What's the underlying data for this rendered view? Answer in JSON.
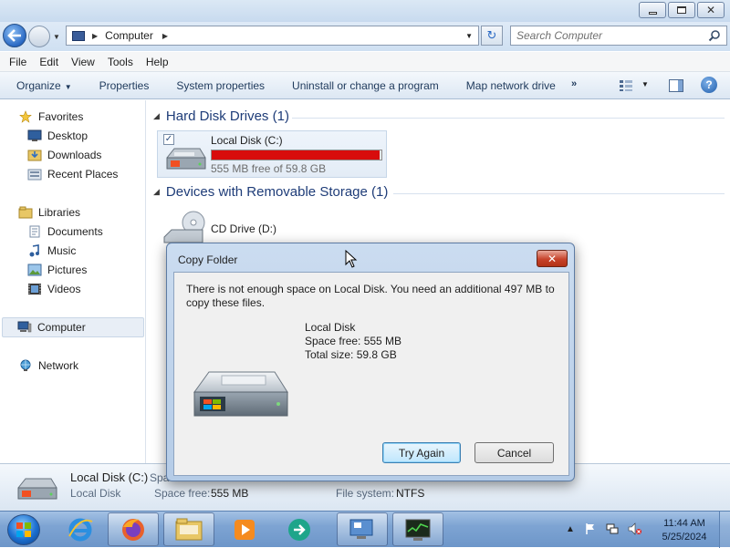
{
  "window": {
    "minimize_icon": "minimize-icon",
    "maximize_icon": "maximize-icon",
    "close_icon": "close-icon",
    "close_glyph": "✕"
  },
  "nav": {
    "address_segments": [
      "Computer"
    ],
    "search_placeholder": "Search Computer"
  },
  "menu": [
    "File",
    "Edit",
    "View",
    "Tools",
    "Help"
  ],
  "commands": {
    "organize": "Organize",
    "properties": "Properties",
    "system_properties": "System properties",
    "uninstall": "Uninstall or change a program",
    "map_drive": "Map network drive",
    "more": "»",
    "help": "?"
  },
  "sidebar": {
    "favorites": "Favorites",
    "favorites_items": [
      "Desktop",
      "Downloads",
      "Recent Places"
    ],
    "libraries": "Libraries",
    "libraries_items": [
      "Documents",
      "Music",
      "Pictures",
      "Videos"
    ],
    "computer": "Computer",
    "network": "Network"
  },
  "content": {
    "hard_disk_group": "Hard Disk Drives (1)",
    "local_disk": {
      "name": "Local Disk (C:)",
      "free_text": "555 MB free of 59.8 GB",
      "used_fraction": 0.99,
      "bar_color": "#d80c0c"
    },
    "removable_group": "Devices with Removable Storage (1)",
    "cd_drive": "CD Drive (D:)"
  },
  "details": {
    "name": "Local Disk (C:)",
    "name_cut": "Spa",
    "type": "Local Disk",
    "space_free_label": "Space free:",
    "space_free_value": "555 MB",
    "filesystem_label": "File system:",
    "filesystem_value": "NTFS"
  },
  "dialog": {
    "title": "Copy Folder",
    "close_glyph": "✕",
    "message": "There is not enough space on Local Disk. You need an additional 497 MB to copy these files.",
    "info_name": "Local Disk",
    "info_free": "Space free: 555 MB",
    "info_total": "Total size: 59.8 GB",
    "try_again": "Try Again",
    "cancel": "Cancel"
  },
  "taskbar": {
    "apps": [
      "internet-explorer",
      "firefox",
      "file-explorer",
      "media-player",
      "app-arrow",
      "remote-desktop",
      "system-monitor"
    ],
    "time": "11:44 AM",
    "date": "5/25/2024"
  }
}
